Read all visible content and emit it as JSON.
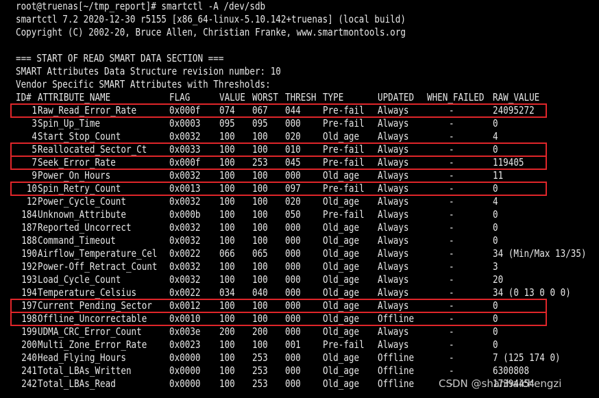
{
  "terminal": {
    "prompt_line": "root@truenas[~/tmp_report]# smartctl -A /dev/sdb",
    "version_line": "smartctl 7.2 2020-12-30 r5155 [x86_64-linux-5.10.142+truenas] (local build)",
    "copyright_line": "Copyright (C) 2002-20, Bruce Allen, Christian Franke, www.smartmontools.org",
    "section_start": "=== START OF READ SMART DATA SECTION ===",
    "revision_line": "SMART Attributes Data Structure revision number: 10",
    "vendor_line": "Vendor Specific SMART Attributes with Thresholds:"
  },
  "table": {
    "headers": {
      "id": "ID#",
      "name": "ATTRIBUTE_NAME",
      "flag": "FLAG",
      "value": "VALUE",
      "worst": "WORST",
      "thresh": "THRESH",
      "type": "TYPE",
      "updated": "UPDATED",
      "when_failed": "WHEN_FAILED",
      "raw": "RAW_VALUE"
    },
    "rows": [
      {
        "id": "1",
        "name": "Raw_Read_Error_Rate",
        "flag": "0x000f",
        "value": "074",
        "worst": "067",
        "thresh": "044",
        "type": "Pre-fail",
        "updated": "Always",
        "when_failed": "-",
        "raw": "24095272",
        "highlighted": true
      },
      {
        "id": "3",
        "name": "Spin_Up_Time",
        "flag": "0x0003",
        "value": "095",
        "worst": "095",
        "thresh": "000",
        "type": "Pre-fail",
        "updated": "Always",
        "when_failed": "-",
        "raw": "0",
        "highlighted": false
      },
      {
        "id": "4",
        "name": "Start_Stop_Count",
        "flag": "0x0032",
        "value": "100",
        "worst": "100",
        "thresh": "020",
        "type": "Old_age",
        "updated": "Always",
        "when_failed": "-",
        "raw": "4",
        "highlighted": false
      },
      {
        "id": "5",
        "name": "Reallocated_Sector_Ct",
        "flag": "0x0033",
        "value": "100",
        "worst": "100",
        "thresh": "010",
        "type": "Pre-fail",
        "updated": "Always",
        "when_failed": "-",
        "raw": "0",
        "highlighted": true
      },
      {
        "id": "7",
        "name": "Seek_Error_Rate",
        "flag": "0x000f",
        "value": "100",
        "worst": "253",
        "thresh": "045",
        "type": "Pre-fail",
        "updated": "Always",
        "when_failed": "-",
        "raw": "119405",
        "highlighted": true
      },
      {
        "id": "9",
        "name": "Power_On_Hours",
        "flag": "0x0032",
        "value": "100",
        "worst": "100",
        "thresh": "000",
        "type": "Old_age",
        "updated": "Always",
        "when_failed": "-",
        "raw": "11",
        "highlighted": false
      },
      {
        "id": "10",
        "name": "Spin_Retry_Count",
        "flag": "0x0013",
        "value": "100",
        "worst": "100",
        "thresh": "097",
        "type": "Pre-fail",
        "updated": "Always",
        "when_failed": "-",
        "raw": "0",
        "highlighted": true
      },
      {
        "id": "12",
        "name": "Power_Cycle_Count",
        "flag": "0x0032",
        "value": "100",
        "worst": "100",
        "thresh": "020",
        "type": "Old_age",
        "updated": "Always",
        "when_failed": "-",
        "raw": "4",
        "highlighted": false
      },
      {
        "id": "184",
        "name": "Unknown_Attribute",
        "flag": "0x000b",
        "value": "100",
        "worst": "100",
        "thresh": "050",
        "type": "Pre-fail",
        "updated": "Always",
        "when_failed": "-",
        "raw": "0",
        "highlighted": false
      },
      {
        "id": "187",
        "name": "Reported_Uncorrect",
        "flag": "0x0032",
        "value": "100",
        "worst": "100",
        "thresh": "000",
        "type": "Old_age",
        "updated": "Always",
        "when_failed": "-",
        "raw": "0",
        "highlighted": false
      },
      {
        "id": "188",
        "name": "Command_Timeout",
        "flag": "0x0032",
        "value": "100",
        "worst": "100",
        "thresh": "000",
        "type": "Old_age",
        "updated": "Always",
        "when_failed": "-",
        "raw": "0",
        "highlighted": false
      },
      {
        "id": "190",
        "name": "Airflow_Temperature_Cel",
        "flag": "0x0022",
        "value": "066",
        "worst": "065",
        "thresh": "000",
        "type": "Old_age",
        "updated": "Always",
        "when_failed": "-",
        "raw": "34 (Min/Max 13/35)",
        "highlighted": false
      },
      {
        "id": "192",
        "name": "Power-Off_Retract_Count",
        "flag": "0x0032",
        "value": "100",
        "worst": "100",
        "thresh": "000",
        "type": "Old_age",
        "updated": "Always",
        "when_failed": "-",
        "raw": "3",
        "highlighted": false
      },
      {
        "id": "193",
        "name": "Load_Cycle_Count",
        "flag": "0x0032",
        "value": "100",
        "worst": "100",
        "thresh": "000",
        "type": "Old_age",
        "updated": "Always",
        "when_failed": "-",
        "raw": "20",
        "highlighted": false
      },
      {
        "id": "194",
        "name": "Temperature_Celsius",
        "flag": "0x0022",
        "value": "034",
        "worst": "040",
        "thresh": "000",
        "type": "Old_age",
        "updated": "Always",
        "when_failed": "-",
        "raw": "34 (0 13 0 0 0)",
        "highlighted": false
      },
      {
        "id": "197",
        "name": "Current_Pending_Sector",
        "flag": "0x0012",
        "value": "100",
        "worst": "100",
        "thresh": "000",
        "type": "Old_age",
        "updated": "Always",
        "when_failed": "-",
        "raw": "0",
        "highlighted": true
      },
      {
        "id": "198",
        "name": "Offline_Uncorrectable",
        "flag": "0x0010",
        "value": "100",
        "worst": "100",
        "thresh": "000",
        "type": "Old_age",
        "updated": "Offline",
        "when_failed": "-",
        "raw": "0",
        "highlighted": true
      },
      {
        "id": "199",
        "name": "UDMA_CRC_Error_Count",
        "flag": "0x003e",
        "value": "200",
        "worst": "200",
        "thresh": "000",
        "type": "Old_age",
        "updated": "Always",
        "when_failed": "-",
        "raw": "0",
        "highlighted": false
      },
      {
        "id": "200",
        "name": "Multi_Zone_Error_Rate",
        "flag": "0x0023",
        "value": "100",
        "worst": "100",
        "thresh": "001",
        "type": "Pre-fail",
        "updated": "Always",
        "when_failed": "-",
        "raw": "0",
        "highlighted": false
      },
      {
        "id": "240",
        "name": "Head_Flying_Hours",
        "flag": "0x0000",
        "value": "100",
        "worst": "253",
        "thresh": "000",
        "type": "Old_age",
        "updated": "Offline",
        "when_failed": "-",
        "raw": "7 (125 174 0)",
        "highlighted": false
      },
      {
        "id": "241",
        "name": "Total_LBAs_Written",
        "flag": "0x0000",
        "value": "100",
        "worst": "253",
        "thresh": "000",
        "type": "Old_age",
        "updated": "Offline",
        "when_failed": "-",
        "raw": "6300808",
        "highlighted": false
      },
      {
        "id": "242",
        "name": "Total_LBAs_Read",
        "flag": "0x0000",
        "value": "100",
        "worst": "253",
        "thresh": "000",
        "type": "Old_age",
        "updated": "Offline",
        "when_failed": "-",
        "raw": "17394454",
        "highlighted": false
      }
    ]
  },
  "watermark": "CSDN @shanhaichengzi",
  "colors": {
    "background": "#000000",
    "text": "#e8e8e8",
    "highlight_border": "#e0262a"
  }
}
